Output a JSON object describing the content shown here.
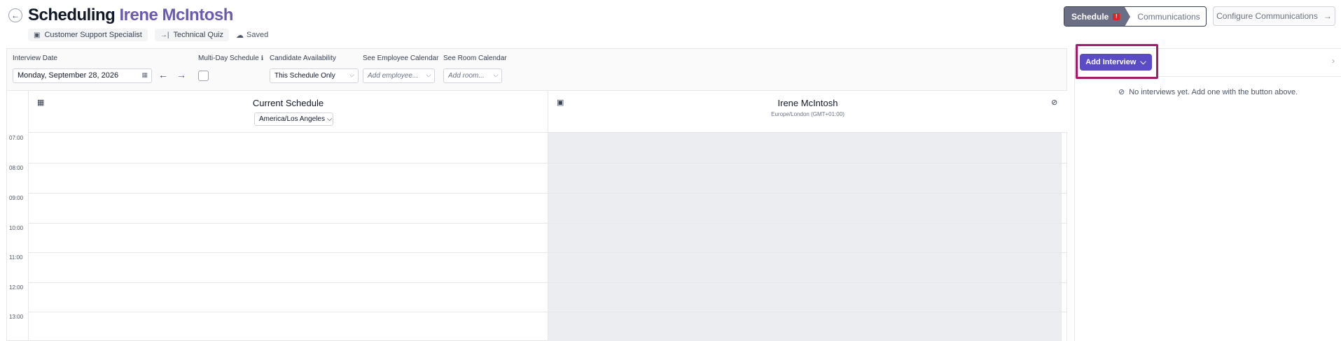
{
  "header": {
    "title_prefix": "Scheduling",
    "candidate_name": "Irene McIntosh",
    "chips": [
      {
        "label": "Customer Support Specialist",
        "icon": "briefcase-icon"
      },
      {
        "label": "Technical Quiz",
        "icon": "arrow-into-icon"
      }
    ],
    "saved_label": "Saved"
  },
  "steps": {
    "active_label": "Schedule",
    "active_badge": "!",
    "next_label": "Communications"
  },
  "config_button": {
    "label": "Configure Communications"
  },
  "filters": {
    "interview_date_label": "Interview Date",
    "interview_date_value": "Monday, September 28, 2026",
    "multi_day_label": "Multi-Day Schedule",
    "multi_day_checked": false,
    "availability_label": "Candidate Availability",
    "availability_value": "This Schedule Only",
    "employee_label": "See Employee Calendar",
    "employee_placeholder": "Add employee...",
    "room_label": "See Room Calendar",
    "room_placeholder": "Add room..."
  },
  "calendar": {
    "current_title": "Current Schedule",
    "current_tz": "America/Los Angeles",
    "candidate_title": "Irene McIntosh",
    "candidate_tz": "Europe/London (GMT+01:00)",
    "hours": [
      "07:00",
      "08:00",
      "09:00",
      "10:00",
      "11:00",
      "12:00",
      "13:00"
    ]
  },
  "right_panel": {
    "add_button_label": "Add Interview",
    "empty_message": "No interviews yet. Add one with the button above."
  }
}
